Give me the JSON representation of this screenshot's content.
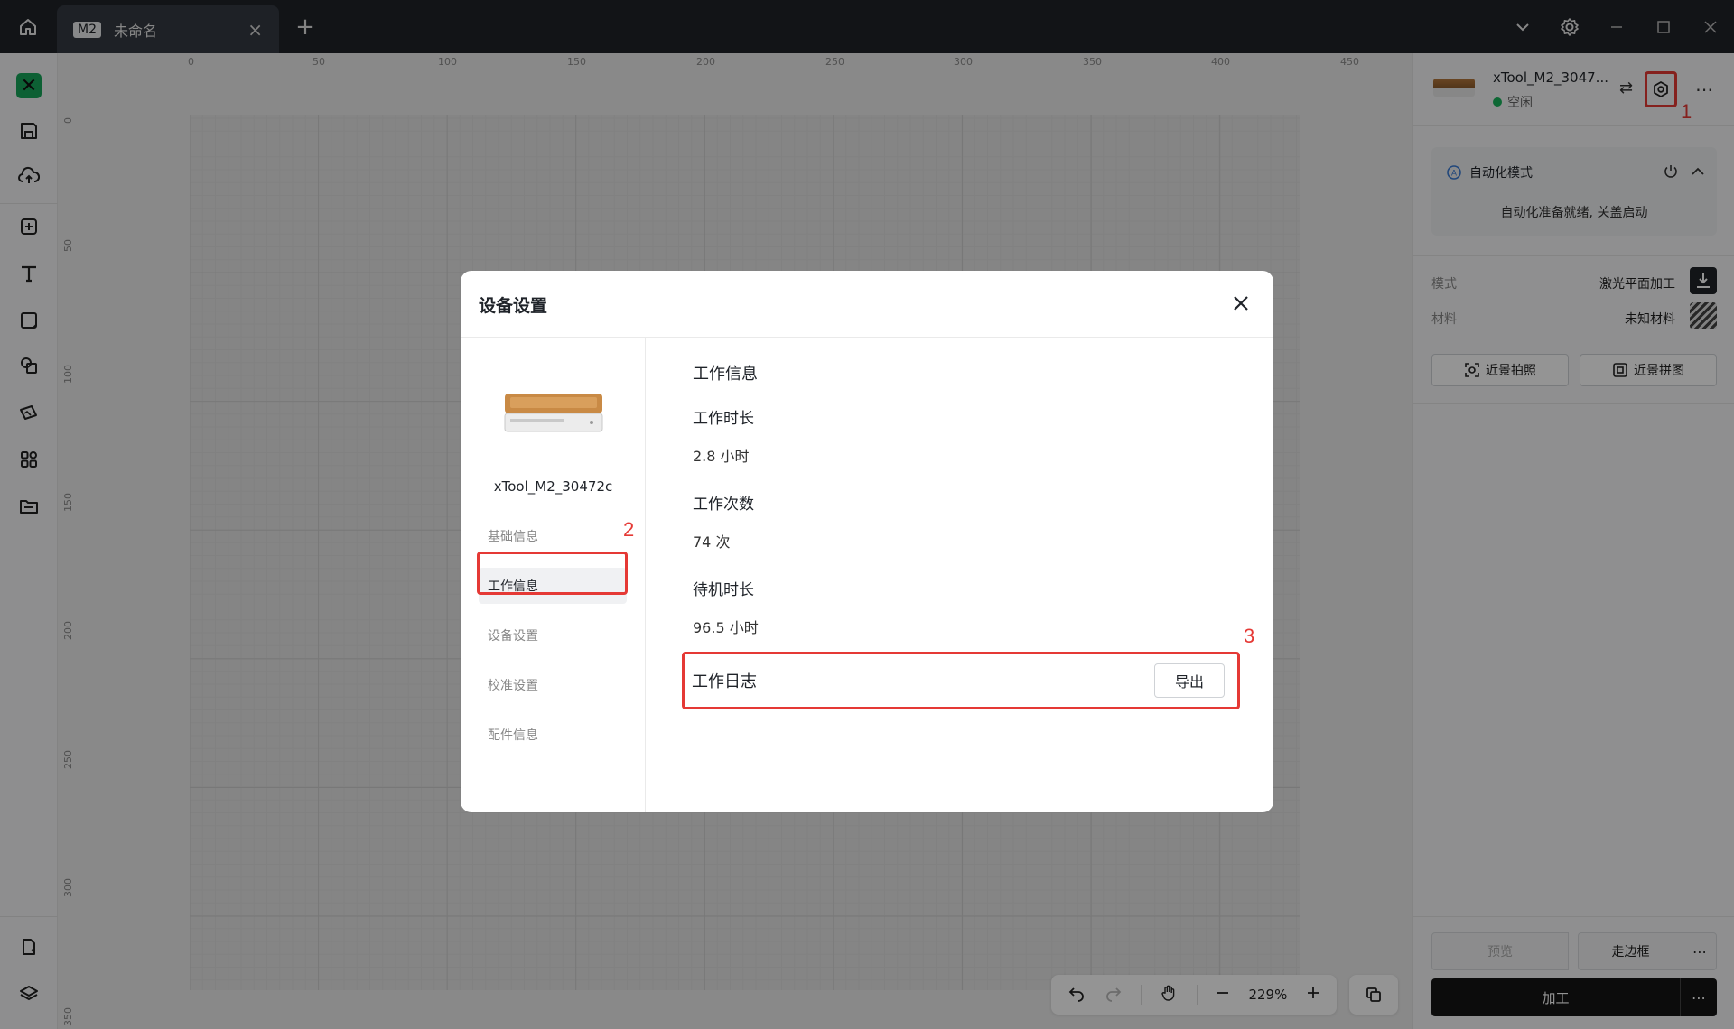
{
  "titlebar": {
    "tab_badge": "M2",
    "tab_title": "未命名",
    "tab_close": "×",
    "tab_add": "+"
  },
  "ruler": {
    "top_labels": [
      "0",
      "50",
      "100",
      "150",
      "200",
      "250",
      "300",
      "350",
      "400",
      "450"
    ],
    "left_labels": [
      "0",
      "50",
      "100",
      "150",
      "200",
      "250",
      "300",
      "350"
    ]
  },
  "zoom": {
    "level": "229%"
  },
  "rightpanel": {
    "device_name": "xTool_M2_3047...",
    "device_status": "空闲",
    "annotation_1": "1",
    "auto_mode_label": "自动化模式",
    "auto_mode_msg": "自动化准备就绪, 关盖启动",
    "mode_label": "模式",
    "mode_value": "激光平面加工",
    "material_label": "材料",
    "material_value": "未知材料",
    "closeup_photo": "近景拍照",
    "closeup_stitch": "近景拼图",
    "preview": "预览",
    "frame": "走边框",
    "process": "加工"
  },
  "modal": {
    "title": "设备设置",
    "device_name": "xTool_M2_30472c",
    "annotation_2": "2",
    "annotation_3": "3",
    "side_items": [
      "基础信息",
      "工作信息",
      "设备设置",
      "校准设置",
      "配件信息"
    ],
    "section_title": "工作信息",
    "work_duration_label": "工作时长",
    "work_duration_value": "2.8 小时",
    "work_count_label": "工作次数",
    "work_count_value": "74 次",
    "standby_label": "待机时长",
    "standby_value": "96.5 小时",
    "log_label": "工作日志",
    "export_label": "导出"
  },
  "colors": {
    "titlebar": "#1f2329",
    "highlight": "#e53935",
    "status_green": "#19b35c",
    "brand_green": "#17a65a"
  }
}
